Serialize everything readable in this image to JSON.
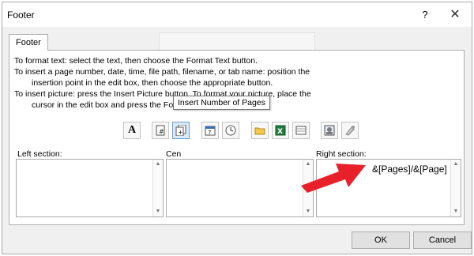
{
  "window": {
    "title": "Footer",
    "help_glyph": "?",
    "close_glyph": "✕"
  },
  "tab": {
    "label": "Footer"
  },
  "instructions": {
    "line1": "To format text:  select the text, then choose the Format Text button.",
    "line2": "To insert a page number, date, time, file path, filename, or tab name:  position the",
    "line3": "insertion point in the edit box, then choose the appropriate button.",
    "line4": "To insert picture: press the Insert Picture button.  To format your picture, place the",
    "line5": "cursor in the edit box and press the Format Picture button."
  },
  "toolbar": {
    "buttons": [
      {
        "name": "format-text-icon",
        "glyph": "A"
      },
      {
        "name": "insert-page-number-icon"
      },
      {
        "name": "insert-number-of-pages-icon",
        "selected": true
      },
      {
        "name": "insert-date-icon"
      },
      {
        "name": "insert-time-icon"
      },
      {
        "name": "insert-file-path-icon"
      },
      {
        "name": "insert-file-name-icon"
      },
      {
        "name": "insert-sheet-name-icon"
      },
      {
        "name": "insert-picture-icon"
      },
      {
        "name": "format-picture-icon"
      }
    ],
    "tooltip": "Insert Number of Pages"
  },
  "sections": {
    "left_label": "Left section:",
    "center_label": "Cen",
    "right_label": "Right section:",
    "right_value": "&[Pages]/&[Page]"
  },
  "buttons": {
    "ok": "OK",
    "cancel": "Cancel"
  },
  "colors": {
    "arrow": "#e8202a",
    "selected_button": "#dbe9f7"
  }
}
